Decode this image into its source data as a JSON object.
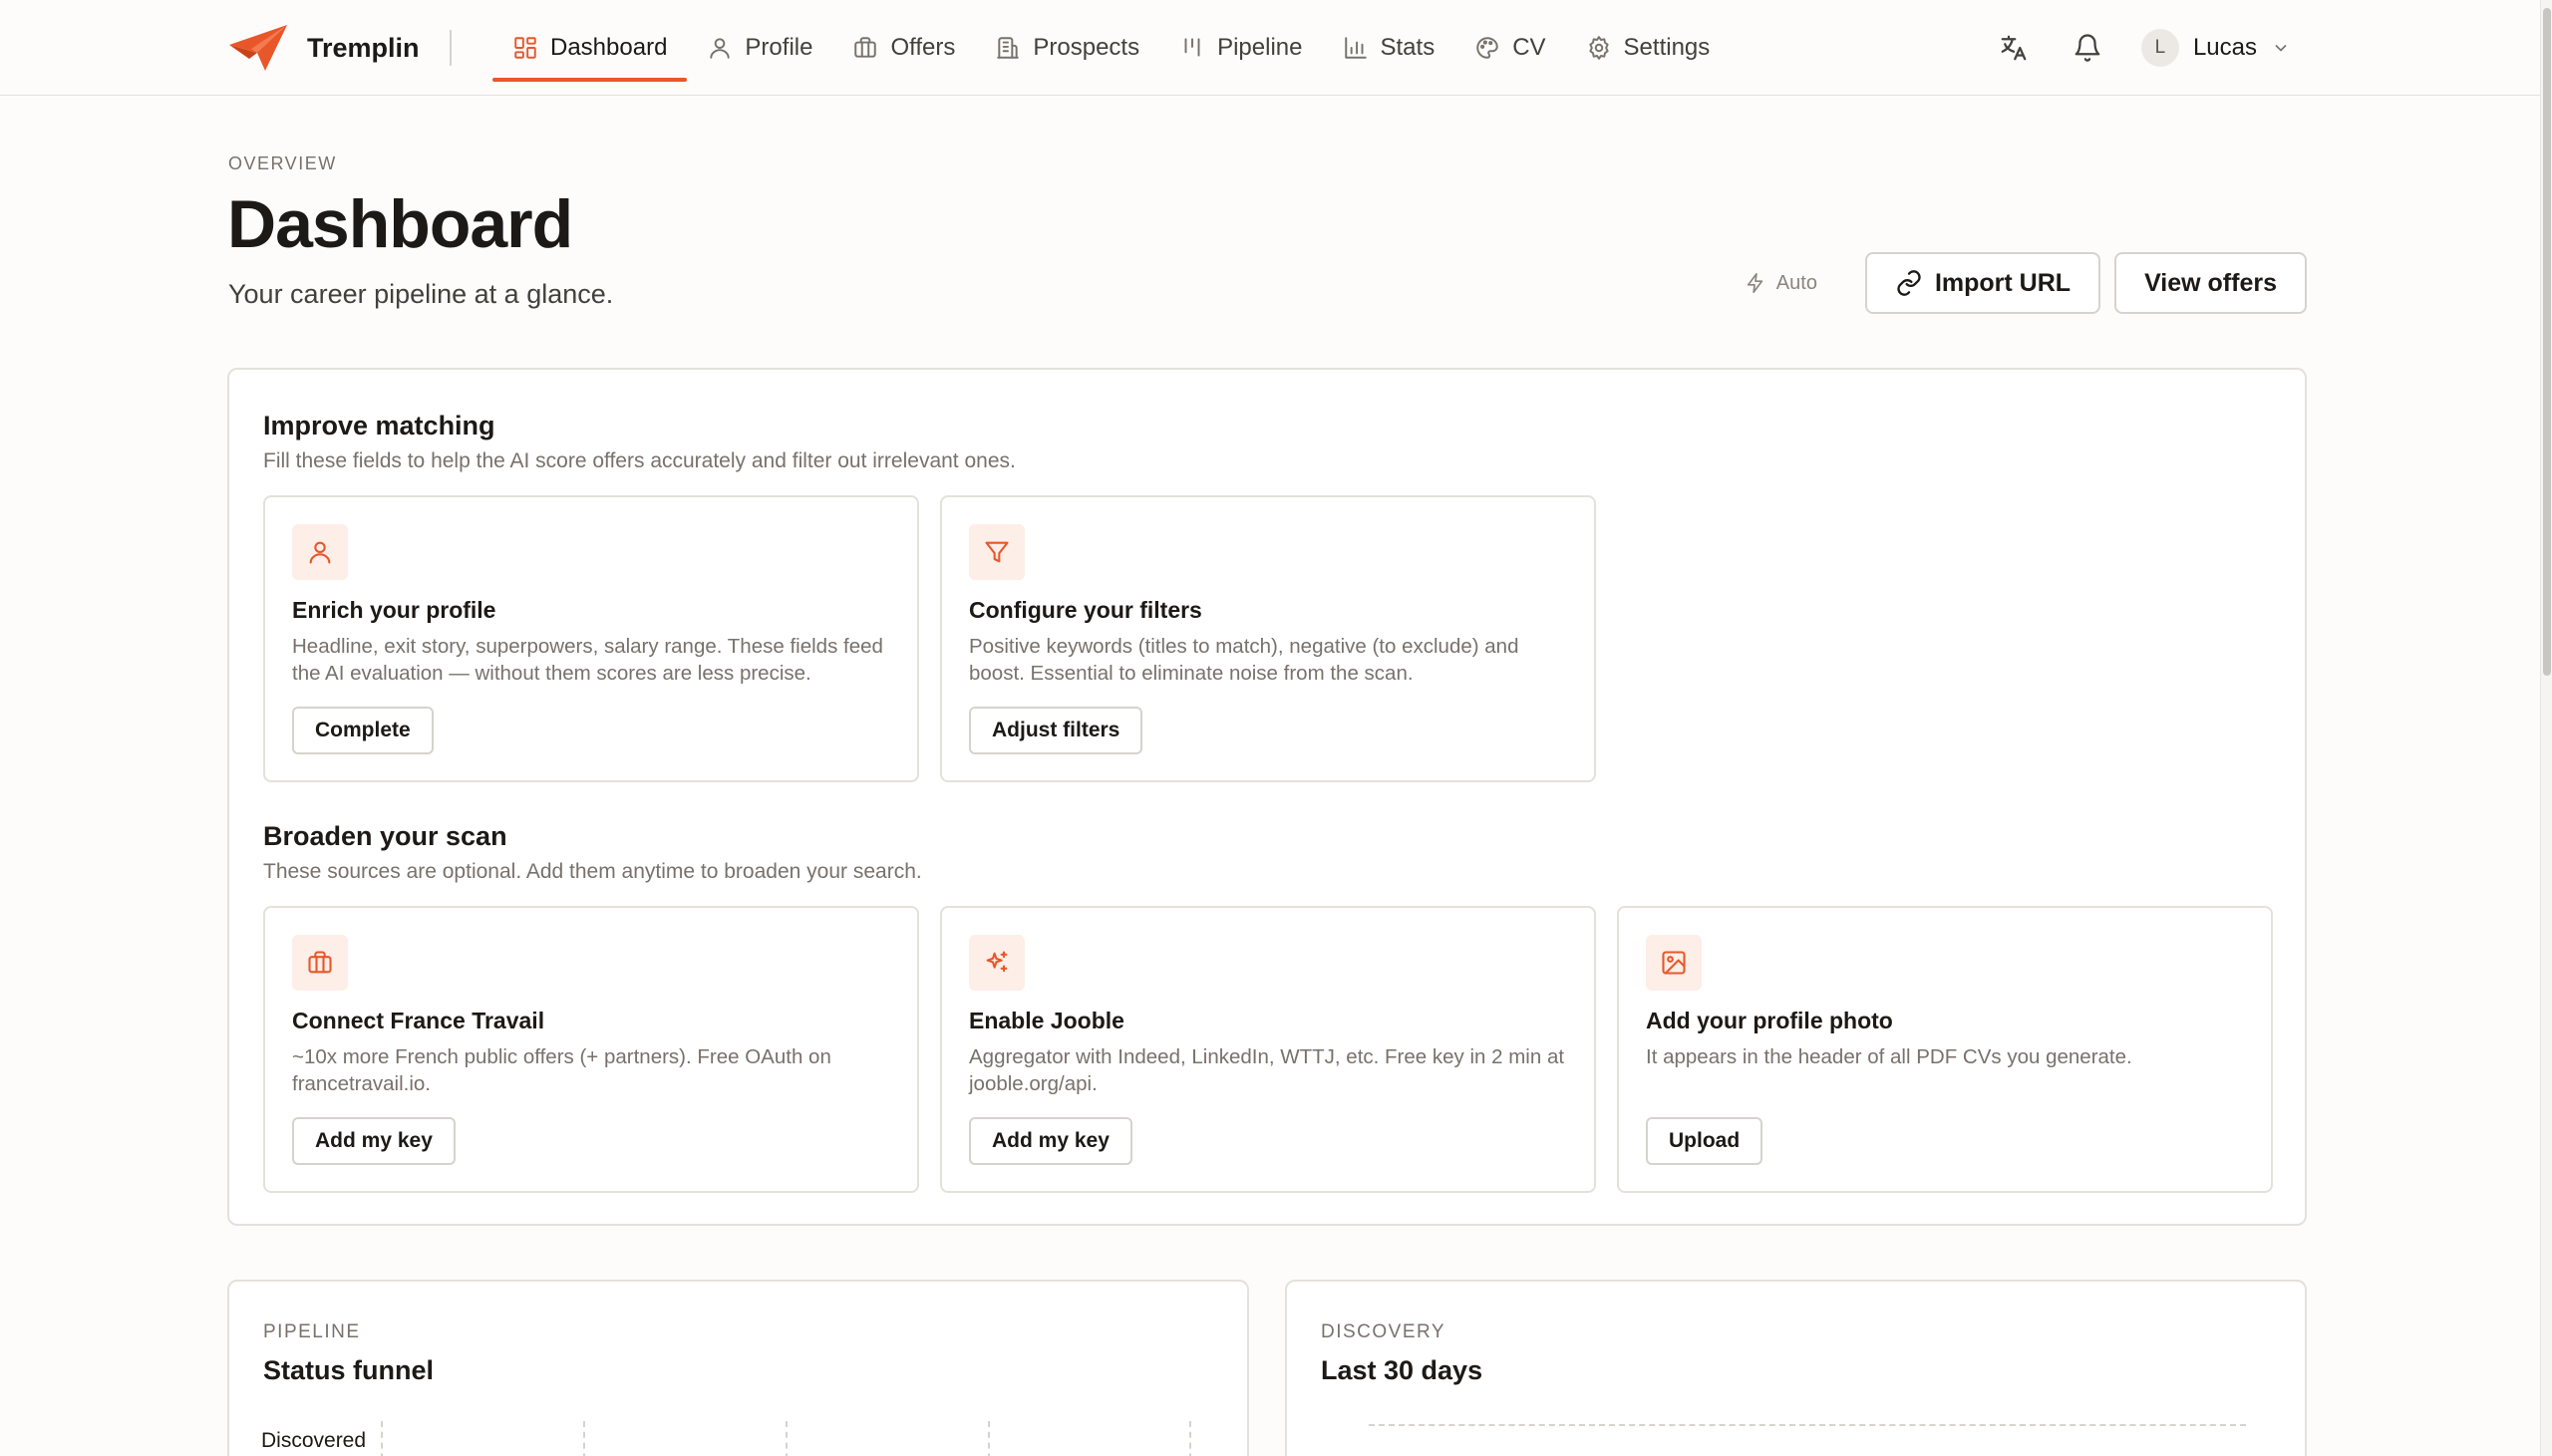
{
  "app": {
    "name": "Tremplin",
    "accent_color": "#e8572a"
  },
  "nav": {
    "items": [
      {
        "label": "Dashboard",
        "icon": "dashboard-icon",
        "active": true
      },
      {
        "label": "Profile",
        "icon": "user-icon"
      },
      {
        "label": "Offers",
        "icon": "briefcase-icon"
      },
      {
        "label": "Prospects",
        "icon": "building-icon"
      },
      {
        "label": "Pipeline",
        "icon": "kanban-icon"
      },
      {
        "label": "Stats",
        "icon": "bar-chart-icon"
      },
      {
        "label": "CV",
        "icon": "palette-icon"
      },
      {
        "label": "Settings",
        "icon": "gear-icon"
      }
    ]
  },
  "user": {
    "initial": "L",
    "name": "Lucas"
  },
  "header": {
    "eyebrow": "OVERVIEW",
    "title": "Dashboard",
    "subtitle": "Your career pipeline at a glance.",
    "auto_label": "Auto",
    "import_label": "Import URL",
    "view_offers_label": "View offers"
  },
  "improve": {
    "title": "Improve matching",
    "subtitle": "Fill these fields to help the AI score offers accurately and filter out irrelevant ones.",
    "cards": [
      {
        "icon": "user-icon",
        "title": "Enrich your profile",
        "desc": "Headline, exit story, superpowers, salary range. These fields feed the AI evaluation — without them scores are less precise.",
        "button": "Complete"
      },
      {
        "icon": "filter-icon",
        "title": "Configure your filters",
        "desc": "Positive keywords (titles to match), negative (to exclude) and boost. Essential to eliminate noise from the scan.",
        "button": "Adjust filters"
      }
    ]
  },
  "broaden": {
    "title": "Broaden your scan",
    "subtitle": "These sources are optional. Add them anytime to broaden your search.",
    "cards": [
      {
        "icon": "briefcase-icon",
        "title": "Connect France Travail",
        "desc": "~10x more French public offers (+ partners). Free OAuth on francetravail.io.",
        "button": "Add my key"
      },
      {
        "icon": "sparkles-icon",
        "title": "Enable Jooble",
        "desc": "Aggregator with Indeed, LinkedIn, WTTJ, etc. Free key in 2 min at jooble.org/api.",
        "button": "Add my key"
      },
      {
        "icon": "image-icon",
        "title": "Add your profile photo",
        "desc": "It appears in the header of all PDF CVs you generate.",
        "button": "Upload"
      }
    ]
  },
  "pipeline": {
    "eyebrow": "PIPELINE",
    "title": "Status funnel",
    "first_label": "Discovered"
  },
  "discovery": {
    "eyebrow": "DISCOVERY",
    "title": "Last 30 days"
  }
}
